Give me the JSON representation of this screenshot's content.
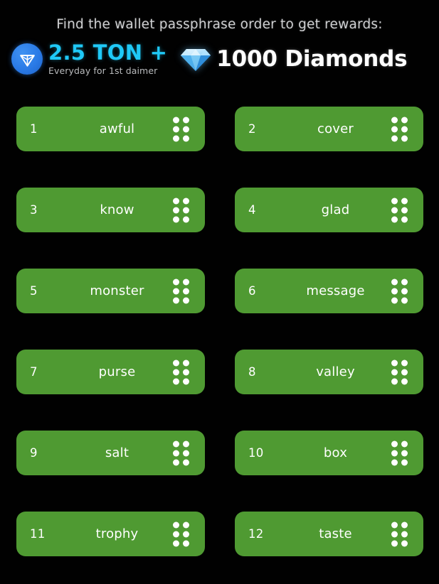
{
  "header": {
    "headline": "Find the wallet passphrase order to get rewards:",
    "rewards": {
      "ton": {
        "icon": "ton-logo-icon",
        "amount": "2.5 TON +",
        "subtitle": "Everyday for 1st daimer",
        "accent_color": "#1fc9f7",
        "logo_color": "#2a7ae6"
      },
      "diamonds": {
        "icon": "diamond-gem-icon",
        "amount": "1000 Diamonds",
        "accent_color": "#ffffff",
        "gem_color": "#67c8f5"
      }
    }
  },
  "passphrase": {
    "chip_color": "#4f9a32",
    "handle_icon": "drag-handle-icon",
    "words": [
      {
        "index": "1",
        "word": "awful"
      },
      {
        "index": "2",
        "word": "cover"
      },
      {
        "index": "3",
        "word": "know"
      },
      {
        "index": "4",
        "word": "glad"
      },
      {
        "index": "5",
        "word": "monster"
      },
      {
        "index": "6",
        "word": "message"
      },
      {
        "index": "7",
        "word": "purse"
      },
      {
        "index": "8",
        "word": "valley"
      },
      {
        "index": "9",
        "word": "salt"
      },
      {
        "index": "10",
        "word": "box"
      },
      {
        "index": "11",
        "word": "trophy"
      },
      {
        "index": "12",
        "word": "taste"
      }
    ]
  }
}
